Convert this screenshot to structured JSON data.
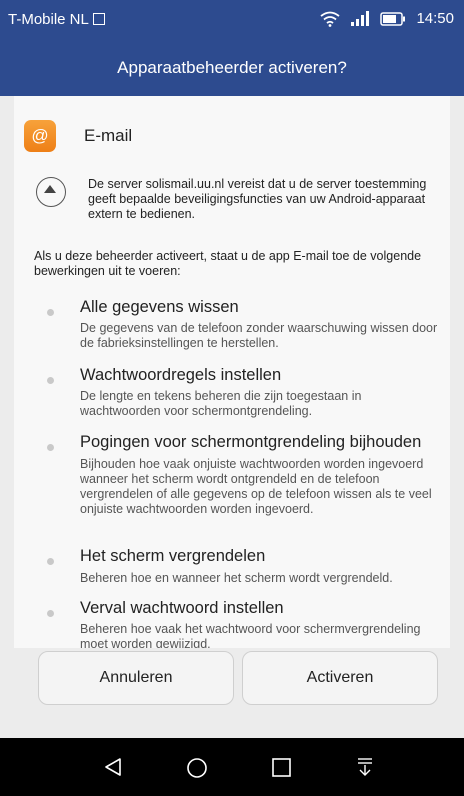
{
  "status_bar": {
    "carrier": "T-Mobile NL",
    "time": "14:50",
    "icons": [
      "sim-card-icon",
      "wifi-icon",
      "signal-icon",
      "battery-icon"
    ]
  },
  "title_bar": {
    "title": "Apparaatbeheerder activeren?"
  },
  "app": {
    "icon_glyph": "@",
    "name": "E-mail"
  },
  "server_notice": "De server solismail.uu.nl vereist dat u de server toestemming geeft bepaalde beveiligingsfuncties van uw Android-apparaat extern te bedienen.",
  "intro": "Als u deze beheerder activeert, staat u de app E-mail toe de volgende bewerkingen uit te voeren:",
  "permissions": [
    {
      "title": "Alle gegevens wissen",
      "description": "De gegevens van de telefoon zonder waarschuwing wissen door de fabrieksinstellingen te herstellen."
    },
    {
      "title": "Wachtwoordregels instellen",
      "description": "De lengte en tekens beheren die zijn toegestaan in wachtwoorden voor schermontgrendeling."
    },
    {
      "title": "Pogingen voor schermontgrendeling bijhouden",
      "description": "Bijhouden hoe vaak onjuiste wachtwoorden worden ingevoerd wanneer het scherm wordt ontgrendeld en de telefoon vergrendelen of alle gegevens op de telefoon wissen als te veel onjuiste wachtwoorden worden ingevoerd."
    },
    {
      "title": "Het scherm vergrendelen",
      "description": "Beheren hoe en wanneer het scherm wordt vergrendeld."
    },
    {
      "title": "Verval wachtwoord instellen",
      "description": "Beheren hoe vaak het wachtwoord voor schermvergrendeling moet worden gewijzigd."
    }
  ],
  "buttons": {
    "cancel": "Annuleren",
    "activate": "Activeren"
  },
  "nav_bar": {
    "icons": [
      "back-icon",
      "home-icon",
      "recents-icon",
      "notification-pull-icon"
    ]
  },
  "colors": {
    "header": "#2d4b8f",
    "app_icon": "#f0891e",
    "nav_bar": "#000000"
  }
}
